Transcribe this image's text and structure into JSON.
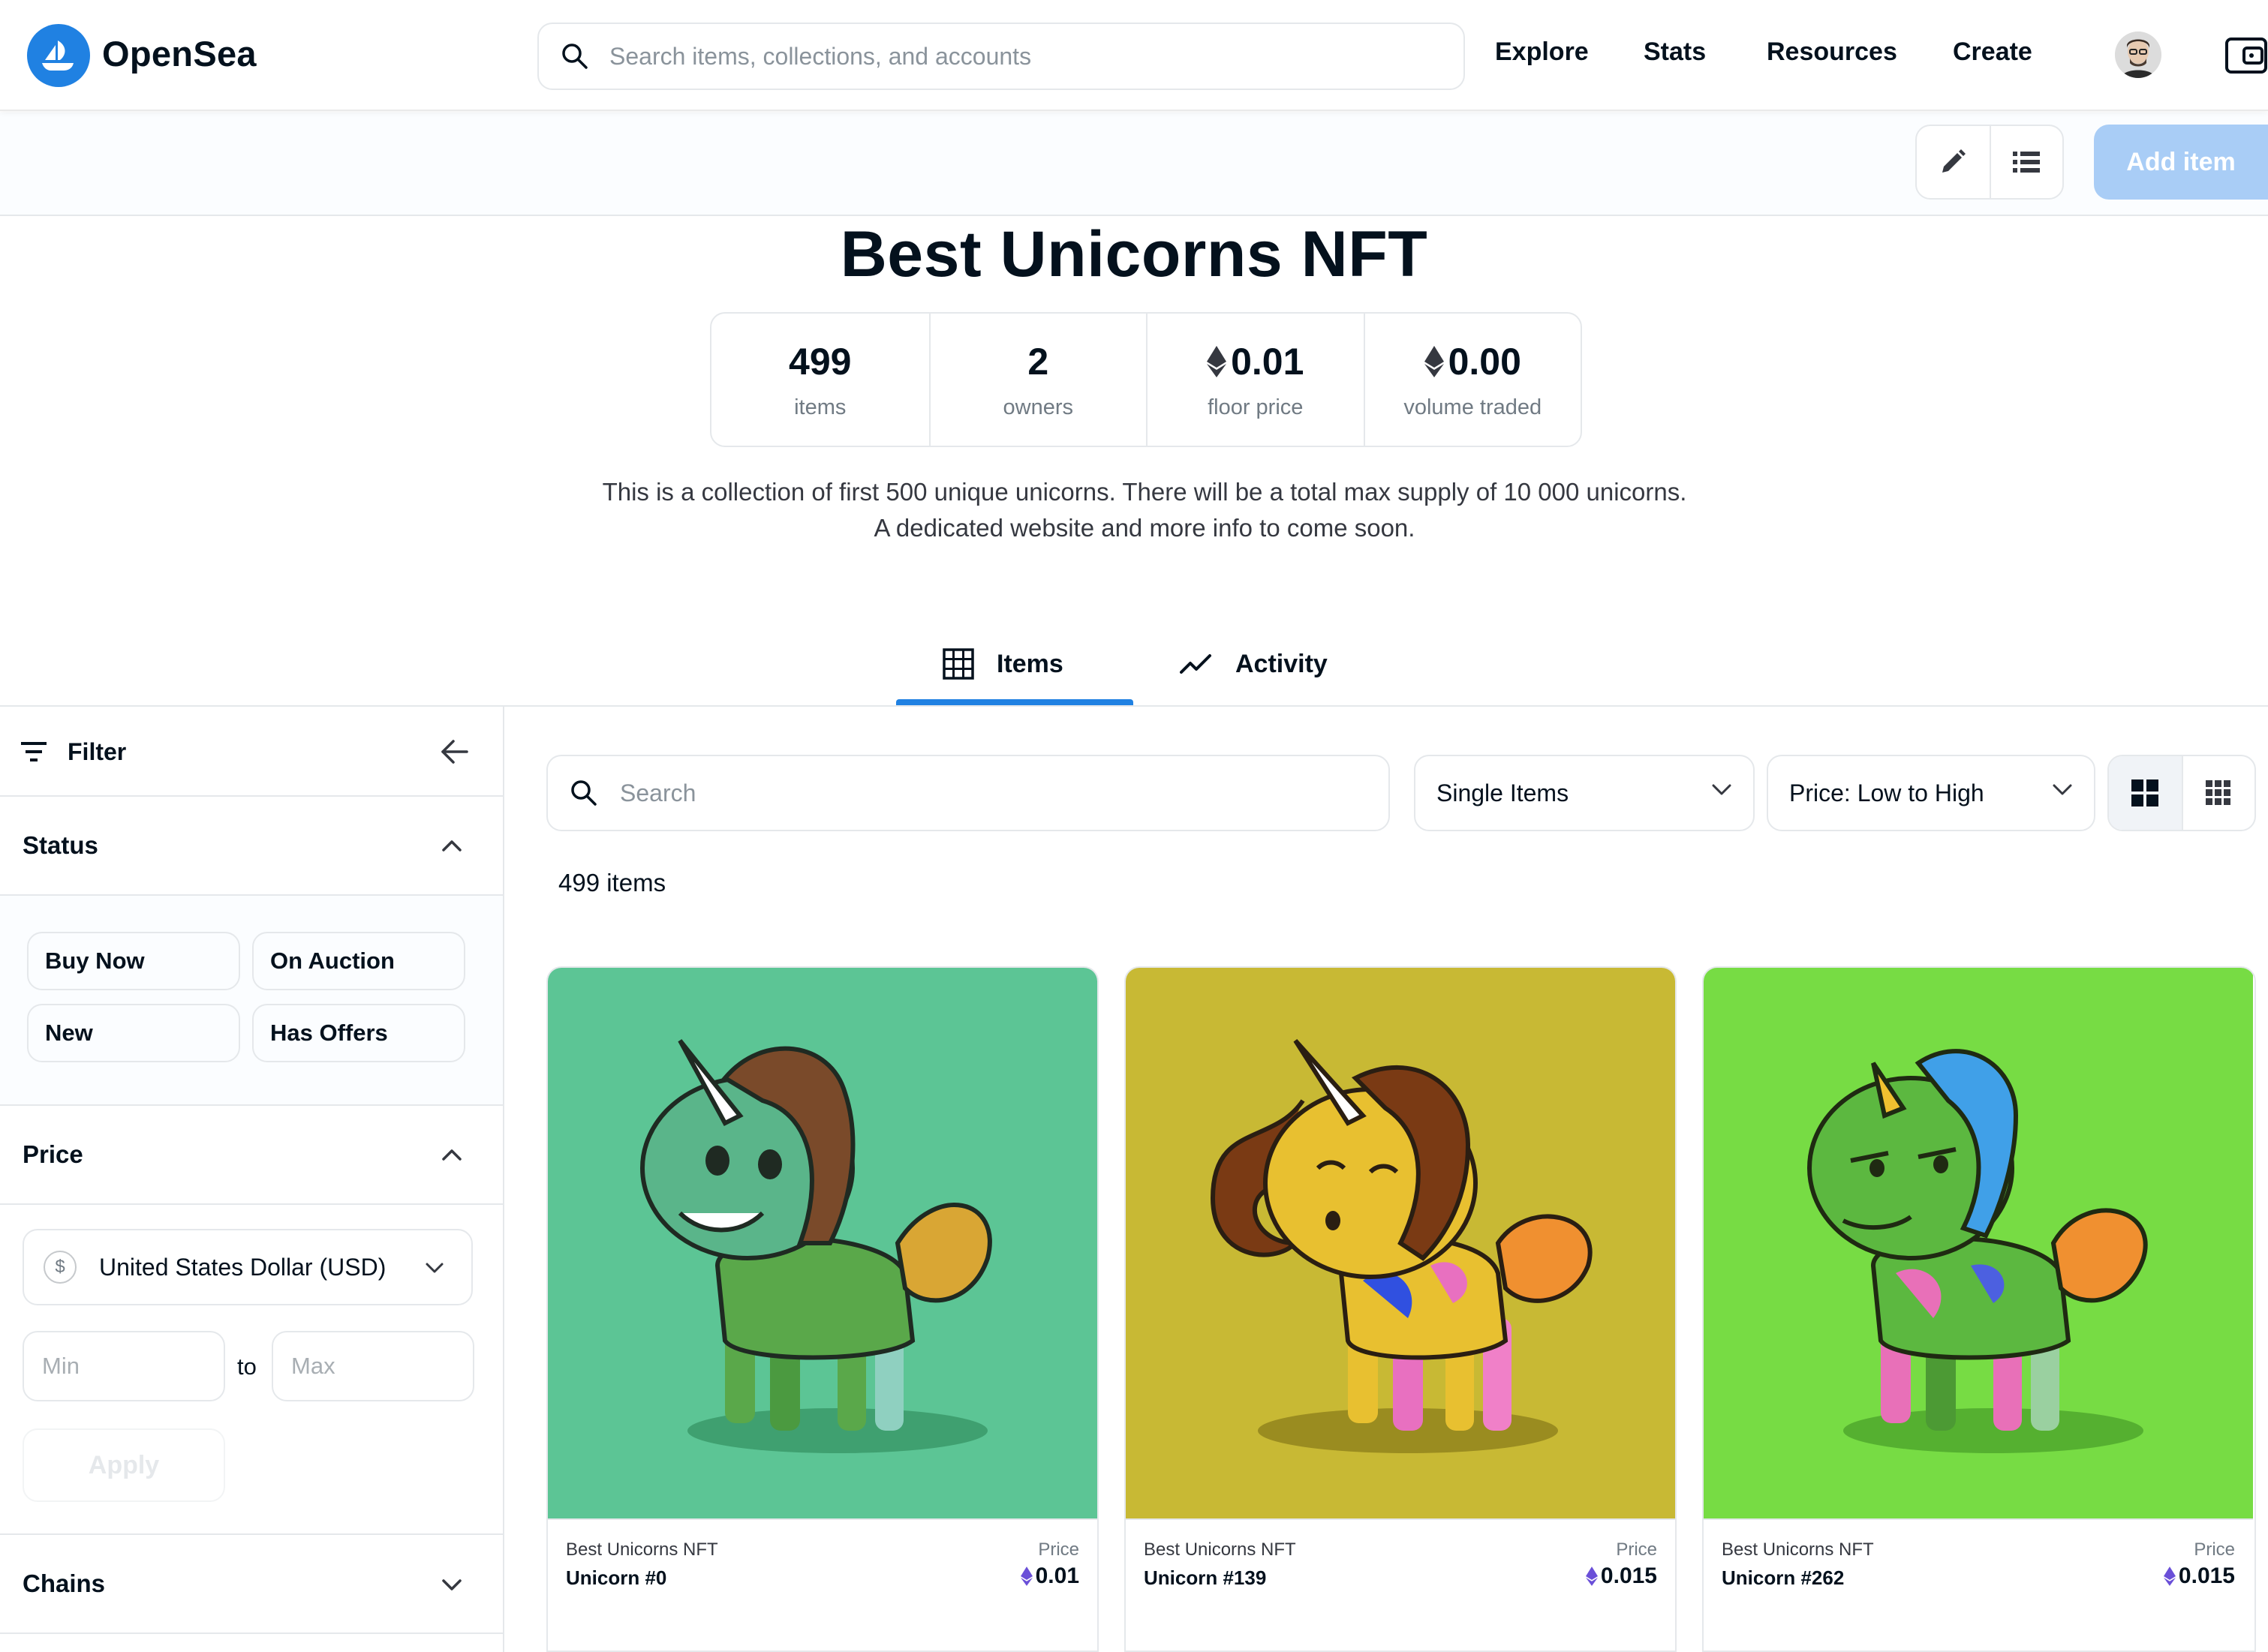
{
  "nav": {
    "brand": "OpenSea",
    "search_placeholder": "Search items, collections, and accounts",
    "links": [
      "Explore",
      "Stats",
      "Resources",
      "Create"
    ]
  },
  "toolbar": {
    "add_item": "Add item"
  },
  "collection": {
    "title": "Best Unicorns NFT",
    "stats": [
      {
        "value": "499",
        "label": "items",
        "eth": false
      },
      {
        "value": "2",
        "label": "owners",
        "eth": false
      },
      {
        "value": "0.01",
        "label": "floor price",
        "eth": true
      },
      {
        "value": "0.00",
        "label": "volume traded",
        "eth": true
      }
    ],
    "description": "This is a collection of first 500 unique unicorns. There will be a total max supply of 10 000 unicorns. A dedicated website and more info to come soon."
  },
  "tabs": [
    {
      "label": "Items",
      "active": true
    },
    {
      "label": "Activity",
      "active": false
    }
  ],
  "sidebar": {
    "filter_label": "Filter",
    "status": {
      "heading": "Status",
      "options": [
        "Buy Now",
        "On Auction",
        "New",
        "Has Offers"
      ]
    },
    "price": {
      "heading": "Price",
      "currency_symbol": "$",
      "currency": "United States Dollar (USD)",
      "min_placeholder": "Min",
      "to_label": "to",
      "max_placeholder": "Max",
      "apply": "Apply"
    },
    "chains": {
      "heading": "Chains"
    }
  },
  "main": {
    "search_placeholder": "Search",
    "item_type": "Single Items",
    "sort": "Price: Low to High",
    "item_count": "499 items"
  },
  "cards": [
    {
      "collection": "Best Unicorns NFT",
      "name": "Unicorn #0",
      "price_label": "Price",
      "price": "0.01",
      "bg": "#5cc595"
    },
    {
      "collection": "Best Unicorns NFT",
      "name": "Unicorn #139",
      "price_label": "Price",
      "price": "0.015",
      "bg": "#c8b934"
    },
    {
      "collection": "Best Unicorns NFT",
      "name": "Unicorn #262",
      "price_label": "Price",
      "price": "0.015",
      "bg": "#77dc44"
    }
  ],
  "colors": {
    "accent": "#2081e2",
    "add_item_bg": "#a9cdf6",
    "eth_purple": "#6a4fd8"
  }
}
